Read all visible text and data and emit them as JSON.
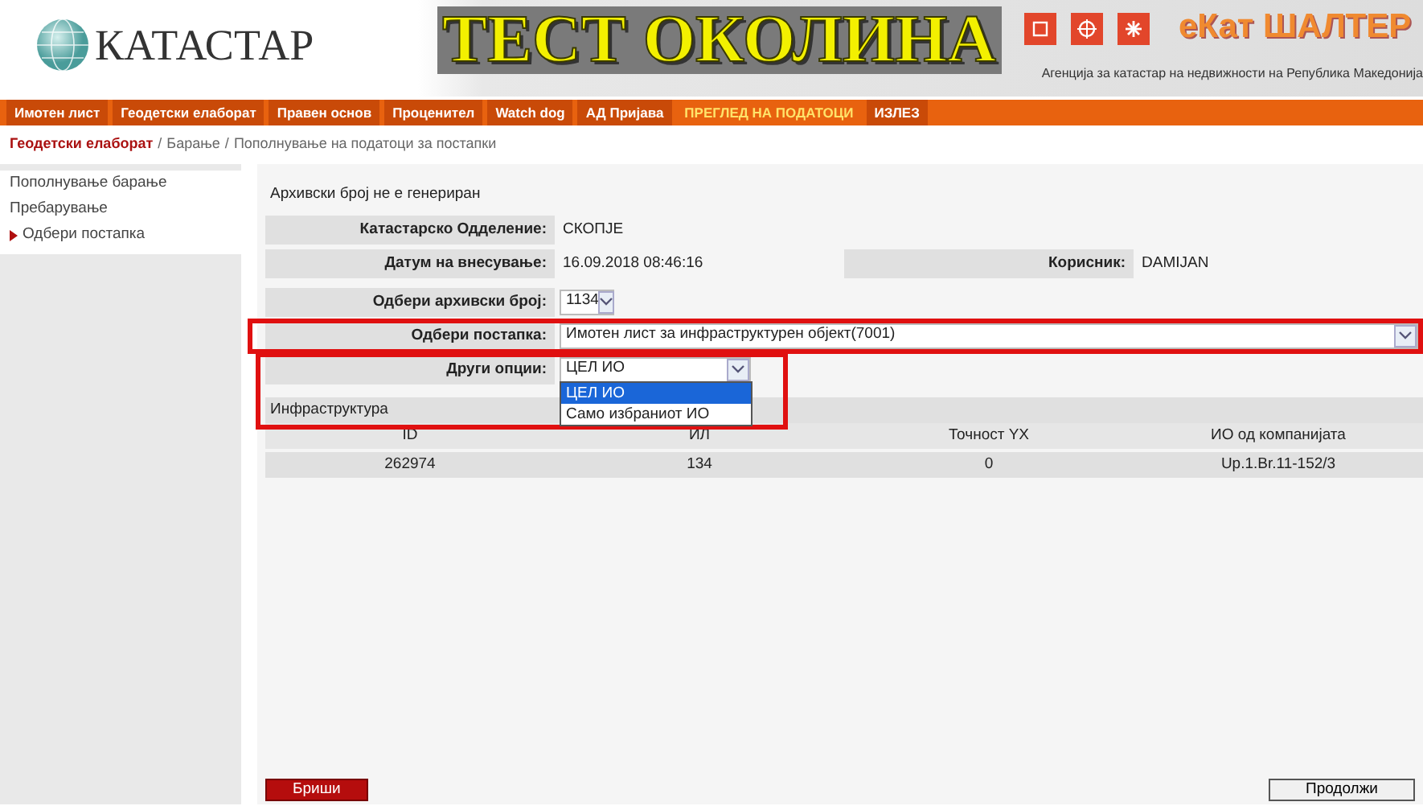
{
  "header": {
    "logo_text": "КАТАСТАР",
    "banner": "ТЕСТ ОКОЛИНА",
    "brand": "еКат ШАЛТЕР",
    "tagline": "Агенција за катастар на недвижности на Република Македонија"
  },
  "nav": [
    {
      "label": "Имотен лист",
      "selected": false
    },
    {
      "label": "Геодетски елаборат",
      "selected": false
    },
    {
      "label": "Правен основ",
      "selected": false
    },
    {
      "label": "Проценител",
      "selected": false
    },
    {
      "label": "Watch dog",
      "selected": false
    },
    {
      "label": "АД Пријава",
      "selected": false
    },
    {
      "label": "ПРЕГЛЕД НА ПОДАТОЦИ",
      "selected": true
    },
    {
      "label": "ИЗЛЕЗ",
      "selected": false
    }
  ],
  "breadcrumb": {
    "separator": "/",
    "items": [
      "Геодетски елаборат",
      "Барање",
      "Пополнување на податоци за постапки"
    ]
  },
  "sidebar": {
    "items": [
      {
        "label": "Пополнување барање",
        "selected": false
      },
      {
        "label": "Пребарување",
        "selected": false
      },
      {
        "label": "Одбери постапка",
        "selected": true
      }
    ]
  },
  "notice": "Архивски број не е генериран",
  "info": {
    "department": {
      "label": "Катастарско Одделение:",
      "value": "СКОПЈЕ"
    },
    "date": {
      "label": "Датум на внесување:",
      "value": "16.09.2018 08:46:16"
    },
    "user": {
      "label": "Корисник:",
      "value": "DAMIJAN"
    }
  },
  "form": {
    "archive": {
      "label": "Одбери архивски број:",
      "value": "1134"
    },
    "procedure": {
      "label": "Одбери постапка:",
      "value": "Имотен лист за инфраструктурен објект(7001)"
    },
    "options": {
      "label": "Други опции:",
      "value": "ЦЕЛ ИО",
      "expanded": true,
      "choices": [
        {
          "label": "ЦЕЛ ИО",
          "selected": true
        },
        {
          "label": "Само избраниот ИО",
          "selected": false
        }
      ]
    }
  },
  "section": "Инфраструктура",
  "table": {
    "columns": [
      "ID",
      "ИЛ",
      "Точност YX",
      "ИО од компанијата"
    ],
    "rows": [
      [
        "262974",
        "134",
        "0",
        "Up.1.Br.11-152/3"
      ]
    ]
  },
  "buttons": {
    "delete": "Бриши",
    "continue": "Продолжи"
  }
}
